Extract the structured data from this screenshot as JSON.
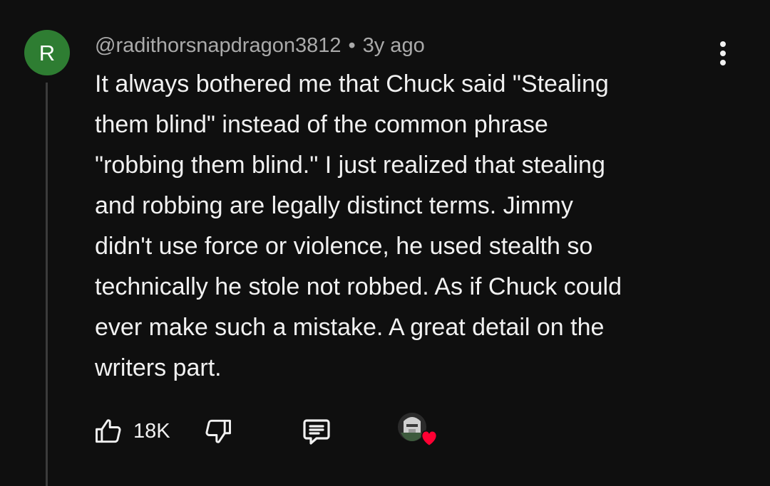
{
  "comment": {
    "avatar_letter": "R",
    "avatar_color": "#2e7d32",
    "author": "@radithorsnapdragon3812",
    "separator": "•",
    "timestamp": "3y ago",
    "text_lines": [
      "It always bothered me that Chuck said \"Stealing",
      "them blind\" instead of the common phrase",
      "\"robbing them blind.\" I just realized that stealing",
      "and robbing are legally distinct terms. Jimmy",
      "didn't use force or violence, he used stealth so",
      "technically he stole not robbed. As if Chuck could",
      "ever make such a mistake. A great detail on the",
      "writers part."
    ]
  },
  "actions": {
    "like_icon": "thumbs-up-icon",
    "like_count": "18K",
    "dislike_icon": "thumbs-down-icon",
    "reply_icon": "reply-comment-icon",
    "hearted_icon": "creator-heart-badge",
    "heart_color": "#ff0033"
  },
  "menu_icon": "more-vertical-icon"
}
